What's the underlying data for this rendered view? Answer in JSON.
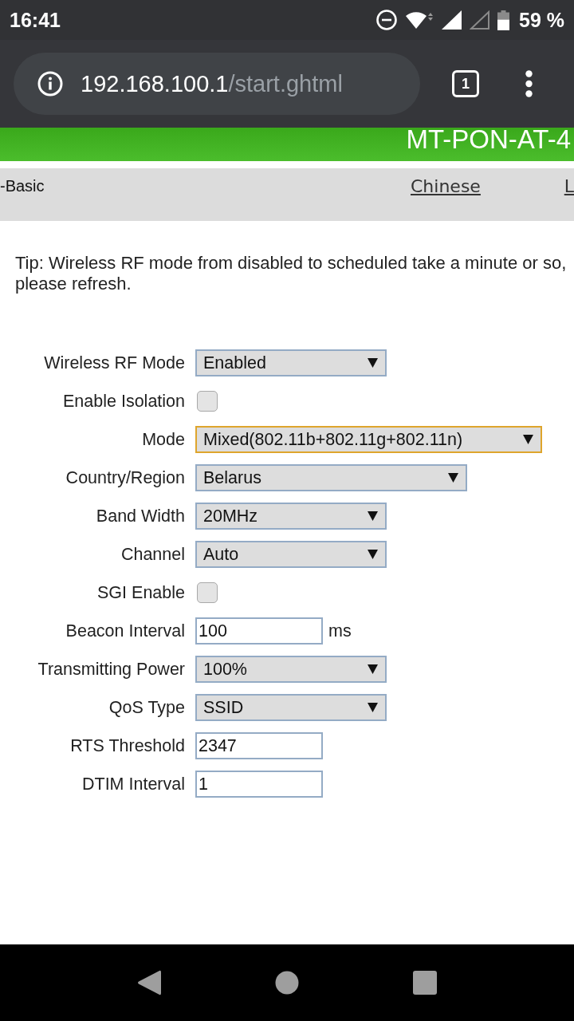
{
  "status_bar": {
    "time": "16:41",
    "battery_text": "59 %"
  },
  "browser": {
    "url_host": "192.168.100.1",
    "url_path": "/start.ghtml",
    "tab_count": "1"
  },
  "header": {
    "title": "MT-PON-AT-4"
  },
  "nav": {
    "breadcrumb": "-Basic",
    "links": [
      {
        "label": "Chinese"
      },
      {
        "label": "L"
      }
    ]
  },
  "tip": "Tip: Wireless RF mode from disabled to scheduled take a minute or so, please refresh.",
  "form": {
    "fields": [
      {
        "kind": "select",
        "label": "Wireless RF Mode",
        "value": "Enabled",
        "focused": false
      },
      {
        "kind": "checkbox",
        "label": "Enable Isolation",
        "checked": false,
        "focused": false
      },
      {
        "kind": "select",
        "label": "Mode",
        "value": "Mixed(802.11b+802.11g+802.11n)",
        "focused": true
      },
      {
        "kind": "select",
        "label": "Country/Region",
        "value": "Belarus",
        "focused": false
      },
      {
        "kind": "select",
        "label": "Band Width",
        "value": "20MHz",
        "focused": false
      },
      {
        "kind": "select",
        "label": "Channel",
        "value": "Auto",
        "focused": false
      },
      {
        "kind": "checkbox",
        "label": "SGI Enable",
        "checked": false,
        "focused": false
      },
      {
        "kind": "text",
        "label": "Beacon Interval",
        "value": "100",
        "unit": "ms",
        "focused": false
      },
      {
        "kind": "select",
        "label": "Transmitting Power",
        "value": "100%",
        "focused": false
      },
      {
        "kind": "select",
        "label": "QoS Type",
        "value": "SSID",
        "focused": false
      },
      {
        "kind": "text",
        "label": "RTS Threshold",
        "value": "2347",
        "focused": false
      },
      {
        "kind": "text",
        "label": "DTIM Interval",
        "value": "1",
        "focused": false
      }
    ]
  }
}
